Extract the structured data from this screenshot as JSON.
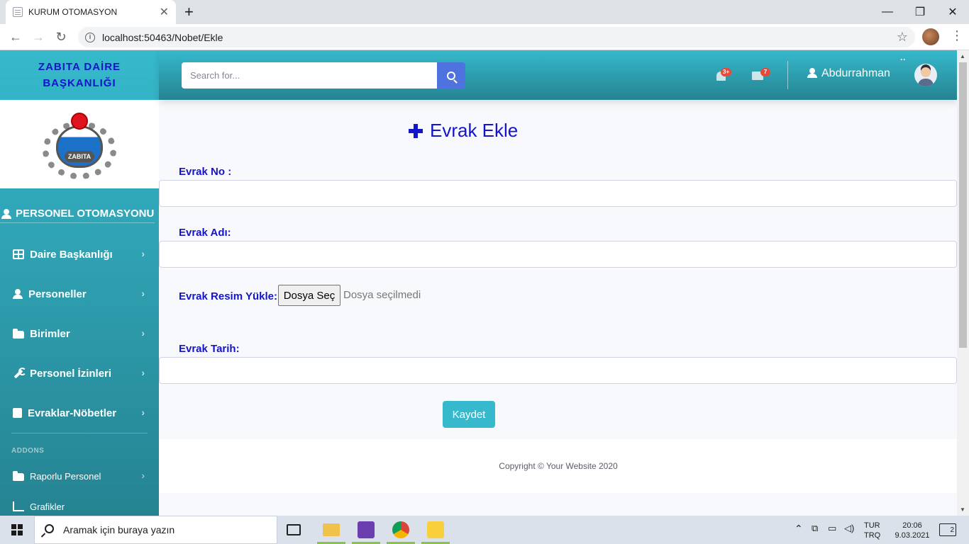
{
  "browser": {
    "tab_title": "KURUM OTOMASYON",
    "tab_close": "✕",
    "new_tab": "+",
    "url": "localhost:50463/Nobet/Ekle",
    "window_controls": {
      "minimize": "—",
      "restore": "❐",
      "close": "✕"
    }
  },
  "sidebar": {
    "brand_line1": "ZABITA DAİRE",
    "brand_line2": "BAŞKANLIĞI",
    "logo_text": "ZABITA",
    "section_title": "PERSONEL OTOMASYONU",
    "items": [
      {
        "label": "Daire Başkanlığı",
        "icon": "table-icon"
      },
      {
        "label": "Personeller",
        "icon": "user-icon"
      },
      {
        "label": "Birimler",
        "icon": "folder-icon"
      },
      {
        "label": "Personel İzinleri",
        "icon": "wrench-icon"
      },
      {
        "label": "Evraklar-Nöbetler",
        "icon": "book-icon"
      }
    ],
    "addons_heading": "ADDONS",
    "addon_items": [
      {
        "label": "Raporlu Personel",
        "icon": "folder-icon"
      },
      {
        "label": "Grafikler",
        "icon": "chart-icon"
      }
    ]
  },
  "topbar": {
    "search_placeholder": "Search for...",
    "alerts_badge": "3+",
    "messages_badge": "7",
    "user_name": "Abdurrahman"
  },
  "form": {
    "heading": "Evrak Ekle",
    "evrak_no_label": "Evrak No :",
    "evrak_adi_label": "Evrak Adı:",
    "resim_label": "Evrak Resim Yükle:",
    "file_button": "Dosya Seç",
    "file_status": "Dosya seçilmedi",
    "tarih_label": "Evrak Tarih:",
    "save_button": "Kaydet"
  },
  "footer": {
    "copyright": "Copyright © Your Website 2020"
  },
  "taskbar": {
    "search_text": "Aramak için buraya yazın",
    "lang_top": "TUR",
    "lang_bottom": "TRQ",
    "time": "20:06",
    "date": "9.03.2021",
    "notification_count": "2"
  },
  "colors": {
    "accent": "#36b9cc",
    "accent_dark": "#258391",
    "form_blue": "#1414c8",
    "search_button": "#4e73df",
    "badge_red": "#e74a3b"
  }
}
